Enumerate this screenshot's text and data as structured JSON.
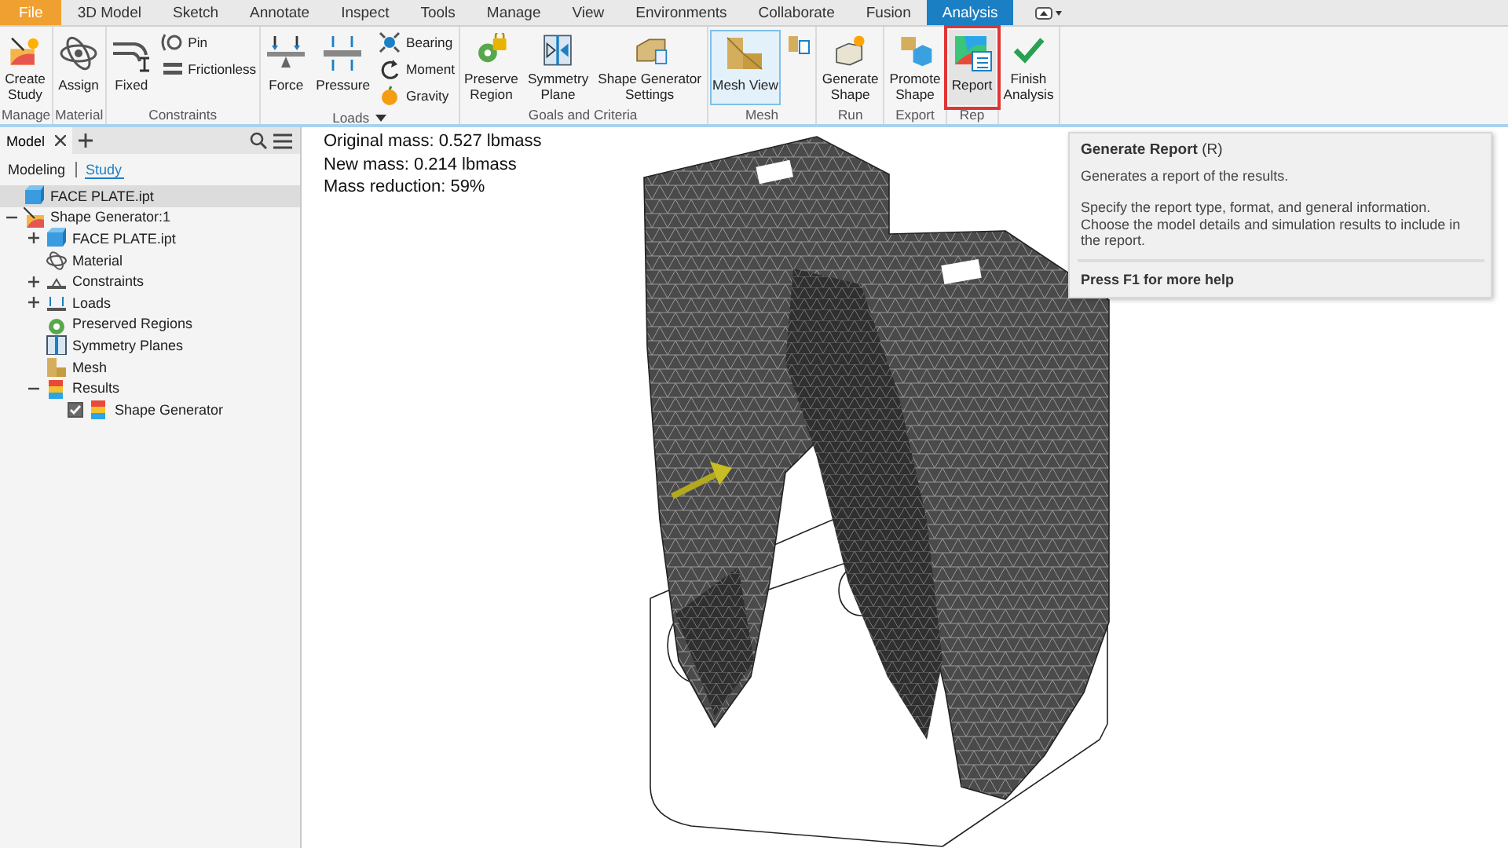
{
  "tabs": [
    {
      "label": "File",
      "kind": "file",
      "selected": false
    },
    {
      "label": "3D Model",
      "kind": "tab",
      "selected": false
    },
    {
      "label": "Sketch",
      "kind": "tab",
      "selected": false
    },
    {
      "label": "Annotate",
      "kind": "tab",
      "selected": false
    },
    {
      "label": "Inspect",
      "kind": "tab",
      "selected": false
    },
    {
      "label": "Tools",
      "kind": "tab",
      "selected": false
    },
    {
      "label": "Manage",
      "kind": "tab",
      "selected": false
    },
    {
      "label": "View",
      "kind": "tab",
      "selected": false
    },
    {
      "label": "Environments",
      "kind": "tab",
      "selected": false
    },
    {
      "label": "Collaborate",
      "kind": "tab",
      "selected": false
    },
    {
      "label": "Fusion",
      "kind": "tab",
      "selected": false
    },
    {
      "label": "Analysis",
      "kind": "tab",
      "selected": true
    }
  ],
  "ribbon": {
    "panels": [
      {
        "title": "Manage",
        "buttons": [
          {
            "label": "Create\nStudy",
            "kind": "large",
            "active": false,
            "highlighted": false
          }
        ]
      },
      {
        "title": "Material",
        "buttons": [
          {
            "label": "Assign",
            "kind": "large",
            "active": false,
            "highlighted": false
          }
        ]
      },
      {
        "title": "Constraints",
        "buttons": [
          {
            "label": "Fixed",
            "kind": "large",
            "active": false,
            "highlighted": false
          },
          {
            "label": "Pin",
            "kind": "small",
            "active": false,
            "highlighted": false
          },
          {
            "label": "Frictionless",
            "kind": "small",
            "active": false,
            "highlighted": false
          }
        ]
      },
      {
        "title": "Loads",
        "dropdown": true,
        "buttons": [
          {
            "label": "Force",
            "kind": "large",
            "active": false,
            "highlighted": false
          },
          {
            "label": "Pressure",
            "kind": "large",
            "active": false,
            "highlighted": false
          },
          {
            "label": "Bearing",
            "kind": "small",
            "active": false,
            "highlighted": false
          },
          {
            "label": "Moment",
            "kind": "small",
            "active": false,
            "highlighted": false
          },
          {
            "label": "Gravity",
            "kind": "small",
            "active": false,
            "highlighted": false
          }
        ]
      },
      {
        "title": "Goals and Criteria",
        "buttons": [
          {
            "label": "Preserve\nRegion",
            "kind": "large",
            "active": false,
            "highlighted": false
          },
          {
            "label": "Symmetry\nPlane",
            "kind": "large",
            "active": false,
            "highlighted": false
          },
          {
            "label": "Shape Generator\nSettings",
            "kind": "large",
            "active": false,
            "highlighted": false
          }
        ]
      },
      {
        "title": "Mesh",
        "buttons": [
          {
            "label": "Mesh View",
            "kind": "large",
            "active": true,
            "highlighted": false
          },
          {
            "kind": "icon",
            "active": false,
            "highlighted": false
          }
        ]
      },
      {
        "title": "Run",
        "buttons": [
          {
            "label": "Generate\nShape",
            "kind": "large",
            "active": false,
            "highlighted": false
          }
        ]
      },
      {
        "title": "Export",
        "buttons": [
          {
            "label": "Promote\nShape",
            "kind": "large",
            "active": false,
            "highlighted": false
          }
        ]
      },
      {
        "title": "Rep",
        "buttons": [
          {
            "label": "Report",
            "kind": "large",
            "active": false,
            "highlighted": true
          }
        ]
      },
      {
        "buttons": [
          {
            "label": "Finish\nAnalysis",
            "kind": "large",
            "active": false,
            "highlighted": false
          }
        ]
      }
    ]
  },
  "browser": {
    "panel_tab": "Model",
    "view_tabs": [
      {
        "label": "Modeling",
        "selected": false
      },
      {
        "label": "Study",
        "selected": true
      }
    ],
    "tree": [
      {
        "label": "FACE PLATE.ipt",
        "selected": true
      },
      {
        "label": "Shape Generator:1",
        "selected": false,
        "expanded": true,
        "children": [
          {
            "label": "FACE PLATE.ipt",
            "selected": false,
            "expanded": false
          },
          {
            "label": "Material",
            "selected": false
          },
          {
            "label": "Constraints",
            "selected": false,
            "expanded": false
          },
          {
            "label": "Loads",
            "selected": false,
            "expanded": false
          },
          {
            "label": "Preserved Regions",
            "selected": false
          },
          {
            "label": "Symmetry Planes",
            "selected": false
          },
          {
            "label": "Mesh",
            "selected": false
          },
          {
            "label": "Results",
            "selected": false,
            "expanded": true,
            "children": [
              {
                "label": "Shape Generator",
                "selected": false,
                "checked": true
              }
            ]
          }
        ]
      }
    ]
  },
  "viewport": {
    "info": [
      "Original mass: 0.527 lbmass",
      "New mass: 0.214 lbmass",
      "Mass reduction: 59%"
    ]
  },
  "tooltip": {
    "title": "**Generate Report** (R)",
    "summary": "Generates a report of the results.",
    "details": "Specify the report type, format, and general information. Choose the model details and simulation results to include in the report.",
    "help": "Press F1 for more help"
  }
}
